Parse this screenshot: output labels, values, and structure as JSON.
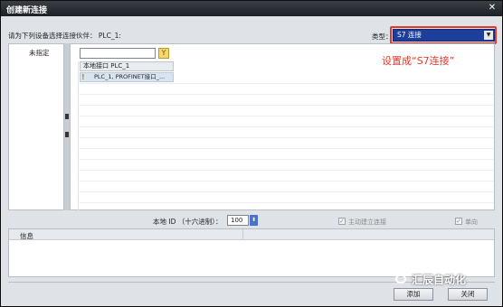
{
  "window": {
    "title": "创建新连接",
    "close": "✕"
  },
  "prompt": {
    "partner_label": "请为下列设备选择连接伙伴：  PLC_1:"
  },
  "type_field": {
    "label": "类型：",
    "selected": "S7 连接"
  },
  "annotation": "设置成“S7连接”",
  "left_tree": {
    "unspecified": "未指定"
  },
  "right_tree": {
    "filter_placeholder": "",
    "column_header": "本地接口 PLC_1",
    "rows": [
      {
        "label": "PLC_1, PROFINET接口_..."
      }
    ]
  },
  "local_id": {
    "label": "本地 ID （十六进制）：",
    "value": "100"
  },
  "options": {
    "active_connect": {
      "label": "主动建立连接",
      "checked": true,
      "disabled": true
    },
    "one_way": {
      "label": "单向",
      "checked": true,
      "disabled": true
    }
  },
  "info": {
    "header": "信息"
  },
  "buttons": {
    "add": "添加",
    "close": "关闭"
  },
  "watermark": "汇辰自动化",
  "colors": {
    "select_bg": "#1c3f9c",
    "annotation": "#e23a2a",
    "title_bg": "#2a2e34"
  }
}
